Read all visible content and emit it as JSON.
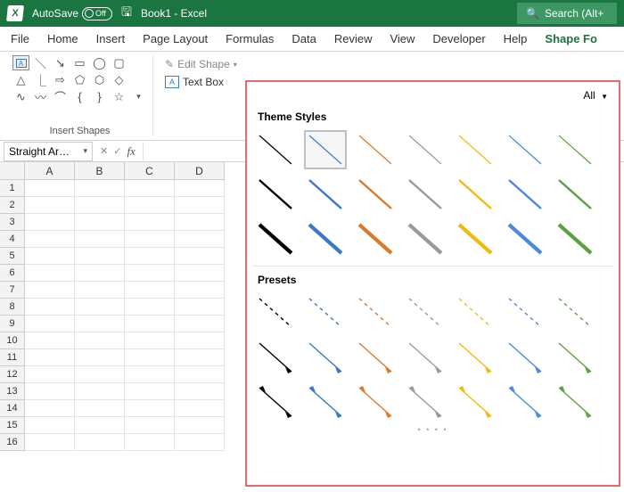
{
  "titlebar": {
    "autosave_label": "AutoSave",
    "autosave_state": "Off",
    "book_title": "Book1 - Excel",
    "search_placeholder": "Search (Alt+"
  },
  "ribbon_tabs": [
    "File",
    "Home",
    "Insert",
    "Page Layout",
    "Formulas",
    "Data",
    "Review",
    "View",
    "Developer",
    "Help",
    "Shape Fo"
  ],
  "active_tab": "Shape Fo",
  "insert_shapes": {
    "group_label": "Insert Shapes",
    "edit_shape": "Edit Shape",
    "text_box": "Text Box"
  },
  "namebox_value": "Straight Ar…",
  "columns": [
    "A",
    "B",
    "C",
    "D"
  ],
  "rows": [
    1,
    2,
    3,
    4,
    5,
    6,
    7,
    8,
    9,
    10,
    11,
    12,
    13,
    14,
    15,
    16
  ],
  "styles_popup": {
    "filter": "All",
    "theme_heading": "Theme Styles",
    "presets_heading": "Presets",
    "colors": [
      "#000000",
      "#3b78c6",
      "#d97b2b",
      "#9a9a9a",
      "#f2b90f",
      "#4a89dc",
      "#5da044"
    ],
    "selected_index": {
      "section": "theme",
      "row": 0,
      "col": 1
    },
    "theme_rows": [
      {
        "weight": 1.2
      },
      {
        "weight": 2.4
      },
      {
        "weight": 4.2
      }
    ],
    "preset_rows": [
      {
        "kind": "dashed",
        "weight": 1.4
      },
      {
        "kind": "arrow",
        "weight": 1.4
      },
      {
        "kind": "double-arrow",
        "weight": 1.4
      }
    ]
  }
}
